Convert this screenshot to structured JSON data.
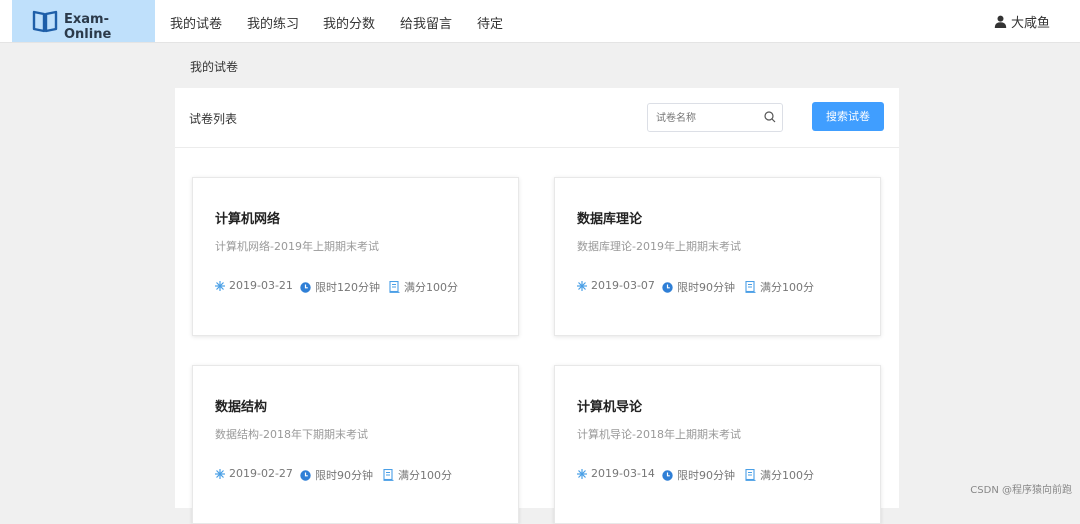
{
  "app": {
    "name": "Exam-Online"
  },
  "nav": {
    "items": [
      "我的试卷",
      "我的练习",
      "我的分数",
      "给我留言",
      "待定"
    ],
    "user": "大咸鱼"
  },
  "breadcrumb": "我的试卷",
  "panel": {
    "title": "试卷列表",
    "search": {
      "placeholder": "试卷名称",
      "button_label": "搜索试卷"
    }
  },
  "cards": [
    {
      "title": "计算机网络",
      "desc": "计算机网络-2019年上期期末考试",
      "date": "2019-03-21",
      "time_limit": "限时120分钟",
      "full_score": "满分100分"
    },
    {
      "title": "数据库理论",
      "desc": "数据库理论-2019年上期期末考试",
      "date": "2019-03-07",
      "time_limit": "限时90分钟",
      "full_score": "满分100分"
    },
    {
      "title": "数据结构",
      "desc": "数据结构-2018年下期期末考试",
      "date": "2019-02-27",
      "time_limit": "限时90分钟",
      "full_score": "满分100分"
    },
    {
      "title": "计算机导论",
      "desc": "计算机导论-2018年上期期末考试",
      "date": "2019-03-14",
      "time_limit": "限时90分钟",
      "full_score": "满分100分"
    }
  ],
  "watermark": "CSDN @程序猿向前跑",
  "colors": {
    "accent": "#409eff",
    "logo_bg": "#bfe0fb",
    "icon_blue": "#4a9fe6"
  }
}
